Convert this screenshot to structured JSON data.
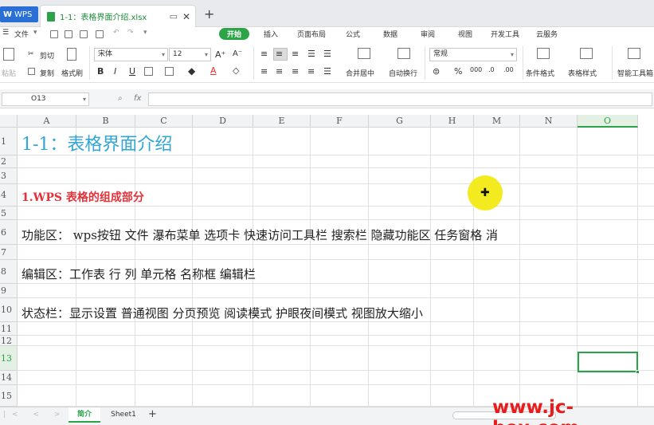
{
  "titlebar": {
    "wps_tab": "WPS",
    "doc_tab": "1-1：表格界面介绍.xlsx",
    "new_tab": "+"
  },
  "menubar": {
    "file": "文件",
    "tabs": [
      "开始",
      "插入",
      "页面布局",
      "公式",
      "数据",
      "审阅",
      "视图",
      "开发工具",
      "云服务"
    ]
  },
  "ribbon": {
    "cut": "剪切",
    "paste": "粘贴",
    "copy": "复制",
    "format_painter": "格式刷",
    "font_name": "宋体",
    "font_size": "12",
    "bold": "B",
    "italic": "I",
    "underline": "U",
    "merge_center": "合并居中",
    "wrap_text": "自动换行",
    "number_format": "常规",
    "percent": "%",
    "conditional_format": "条件格式",
    "table_style": "表格样式",
    "smart_toolbox": "智能工具箱"
  },
  "formula_bar": {
    "name_box": "O13",
    "fx": "fx",
    "content": ""
  },
  "columns": [
    "A",
    "B",
    "C",
    "D",
    "E",
    "F",
    "G",
    "H",
    "M",
    "N",
    "O"
  ],
  "rows": [
    "1",
    "2",
    "3",
    "4",
    "5",
    "6",
    "7",
    "8",
    "9",
    "10",
    "11",
    "12",
    "13",
    "14",
    "15"
  ],
  "cells": {
    "r1": "1-1：表格界面介绍",
    "r4": "1.WPS 表格的组成部分",
    "r6": "功能区： wps按钮 文件  瀑布菜单 选项卡  快速访问工具栏  搜索栏  隐藏功能区 任务窗格 消",
    "r8": "编辑区：工作表 行 列  单元格 名称框 编辑栏",
    "r10": "状态栏：显示设置  普通视图 分页预览  阅读模式  护眼夜间模式  视图放大缩小"
  },
  "sheet_tabs": [
    "简介",
    "Sheet1"
  ],
  "watermark": "www.jc-box.com",
  "colors": {
    "accent": "#2aa24a",
    "title": "#31a6d6",
    "heading": "#e5323a",
    "watermark": "#e81c1c"
  }
}
